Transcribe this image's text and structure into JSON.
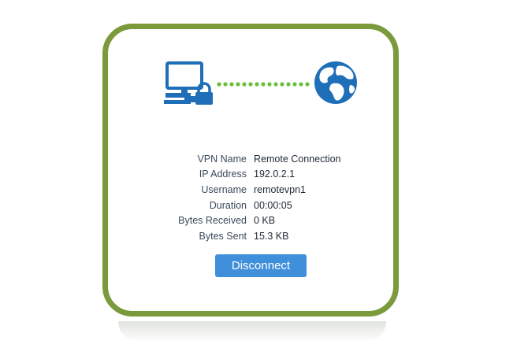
{
  "connection": {
    "rows": [
      {
        "label": "VPN Name",
        "value": "Remote Connection"
      },
      {
        "label": "IP Address",
        "value": "192.0.2.1"
      },
      {
        "label": "Username",
        "value": "remotevpn1"
      },
      {
        "label": "Duration",
        "value": "00:00:05"
      },
      {
        "label": "Bytes Received",
        "value": "0 KB"
      },
      {
        "label": "Bytes Sent",
        "value": "15.3 KB"
      }
    ]
  },
  "actions": {
    "disconnect_label": "Disconnect"
  },
  "icons": {
    "computer": "computer-lock-icon",
    "globe": "globe-icon",
    "link": "dotted-connection-line"
  },
  "colors": {
    "frame": "#7a9a3c",
    "icon_blue": "#1f6fb8",
    "dots_green": "#6abf3a",
    "button": "#3f8fdb"
  }
}
